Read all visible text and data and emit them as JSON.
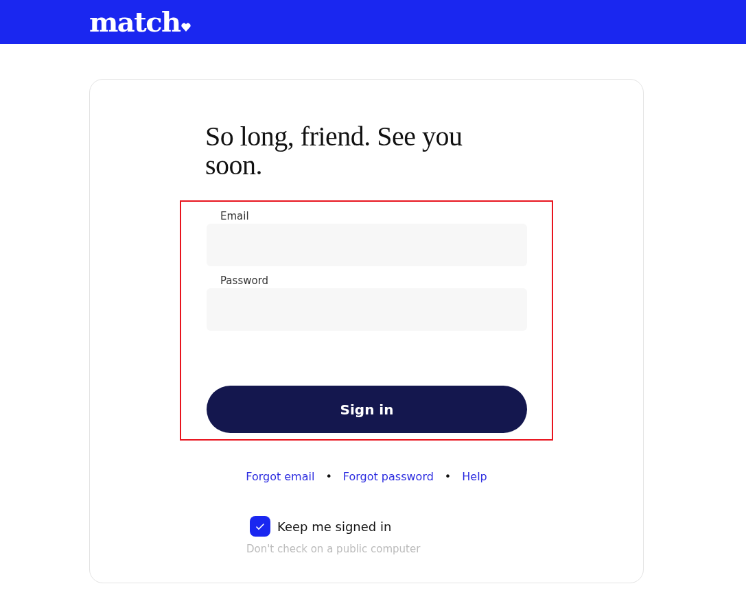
{
  "header": {
    "logo": "match"
  },
  "heading": "So long, friend. See you soon.",
  "form": {
    "highlighted": true,
    "fields": [
      {
        "label": "Email"
      },
      {
        "label": "Password"
      }
    ],
    "submit": "Sign in"
  },
  "links": [
    {
      "kind": "link",
      "text": "Forgot email"
    },
    {
      "kind": "separator",
      "text": "•"
    },
    {
      "kind": "link",
      "text": "Forgot password"
    },
    {
      "kind": "separator",
      "text": "•"
    },
    {
      "kind": "link",
      "text": "Help"
    }
  ],
  "keep_signed_in": {
    "label": "Keep me signed in",
    "checked": true,
    "hint": "Don't check on a public computer"
  }
}
